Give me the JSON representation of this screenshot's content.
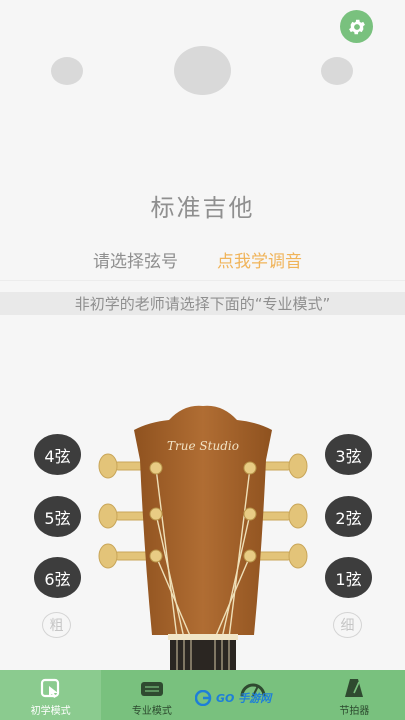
{
  "header": {
    "settings_icon": "gear-icon"
  },
  "instrument": {
    "title": "标准吉他"
  },
  "selection": {
    "prompt": "请选择弦号",
    "learn_link": "点我学调音"
  },
  "hint": "非初学的老师请选择下面的“专业模式”",
  "brand": "True Studio",
  "strings_left": [
    {
      "label": "4弦"
    },
    {
      "label": "5弦"
    },
    {
      "label": "6弦"
    }
  ],
  "strings_right": [
    {
      "label": "3弦"
    },
    {
      "label": "2弦"
    },
    {
      "label": "1弦"
    }
  ],
  "thick_label": "粗",
  "thin_label": "细",
  "tabs": [
    {
      "label": "初学模式",
      "icon": "beginner-mode-icon",
      "active": true
    },
    {
      "label": "专业模式",
      "icon": "pro-mode-icon",
      "active": false
    },
    {
      "label": "",
      "icon": "tuner-icon",
      "active": false
    },
    {
      "label": "节拍器",
      "icon": "metronome-icon",
      "active": false
    }
  ],
  "watermark": {
    "text": "GO 手游网"
  },
  "colors": {
    "accent_green": "#79c17e",
    "learn_orange": "#f0b45a",
    "button_dark": "#3d3d3d",
    "headstock_wood": "#a8642d",
    "peg_gold": "#e3c479"
  }
}
